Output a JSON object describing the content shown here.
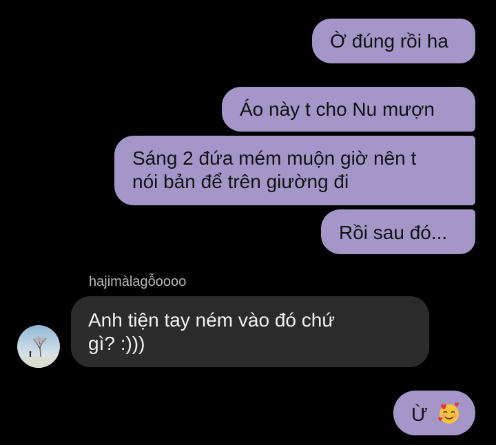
{
  "messages": [
    {
      "direction": "outgoing",
      "text": "Ờ đúng rồi ha"
    },
    {
      "direction": "outgoing",
      "text": "Áo này t cho Nu mượn"
    },
    {
      "direction": "outgoing",
      "lines": [
        "Sáng 2 đứa mém muộn giờ nên t",
        "nói bản để trên giường đi"
      ]
    },
    {
      "direction": "outgoing",
      "text": "Rồi sau đó..."
    },
    {
      "direction": "incoming",
      "sender": "hajimàlagỗoooo",
      "lines": [
        "Anh tiện tay ném vào đó chứ",
        "gì? :)))"
      ]
    },
    {
      "direction": "outgoing",
      "text": "Ừ",
      "emoji": "smiling-face-with-hearts"
    }
  ],
  "colors": {
    "background": "#000000",
    "outgoing_bubble": "#a596c9",
    "incoming_bubble": "#2b2b2b",
    "sender_name": "#b9b9b9"
  }
}
